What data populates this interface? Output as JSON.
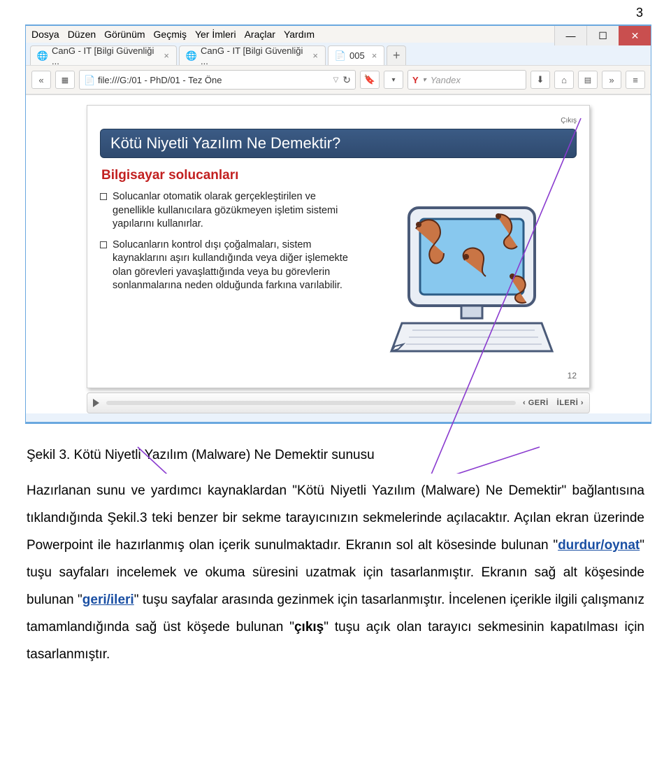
{
  "page_number": "3",
  "menubar": {
    "items": [
      "Dosya",
      "Düzen",
      "Görünüm",
      "Geçmiş",
      "Yer İmleri",
      "Araçlar",
      "Yardım"
    ]
  },
  "tabs": [
    {
      "label": "CanG - IT [Bilgi Güvenliği ..."
    },
    {
      "label": "CanG - IT [Bilgi Güvenliği ..."
    },
    {
      "label": "005"
    }
  ],
  "url": "file:///G:/01 - PhD/01 - Tez Öne",
  "search": {
    "engine_letter": "Y",
    "placeholder": "Yandex"
  },
  "slide": {
    "close": "Çıkış",
    "title": "Kötü Niyetli Yazılım Ne Demektir?",
    "subtitle": "Bilgisayar solucanları",
    "bullets": [
      "Solucanlar otomatik olarak gerçekleştirilen ve genellikle kullanıcılara gözükmeyen işletim sistemi yapılarını kullanırlar.",
      "Solucanların kontrol dışı çoğalmaları, sistem kaynaklarını aşırı kullandığında veya diğer işlemekte olan görevleri yavaşlattığında veya bu görevlerin sonlanmalarına neden olduğunda farkına varılabilir."
    ],
    "number": "12",
    "nav_back": "GERİ",
    "nav_next": "İLERİ"
  },
  "caption": "Şekil 3. Kötü Niyetli Yazılım (Malware) Ne Demektir sunusu",
  "paragraph": {
    "t1": "Hazırlanan sunu ve yardımcı kaynaklardan \"Kötü Niyetli Yazılım (Malware) Ne Demektir\" bağlantısına tıklandığında Şekil.3 teki benzer bir sekme tarayıcınızın sekmelerinde açılacaktır. Açılan ekran üzerinde Powerpoint ile hazırlanmış olan içerik sunulmaktadır. Ekranın sol alt kösesinde bulunan \"",
    "term1": "durdur/oynat",
    "t2": "\" tuşu sayfaları incelemek ve okuma süresini uzatmak için tasarlanmıştır. Ekranın sağ alt köşesinde bulunan \"",
    "term2": "geri/ileri",
    "t3": "\" tuşu sayfalar arasında gezinmek için tasarlanmıştır. İncelenen içerikle ilgili çalışmanız tamamlandığında sağ üst köşede bulunan \"",
    "term3": "çıkış",
    "t4": "\" tuşu açık olan tarayıcı sekmesinin kapatılması için tasarlanmıştır."
  }
}
